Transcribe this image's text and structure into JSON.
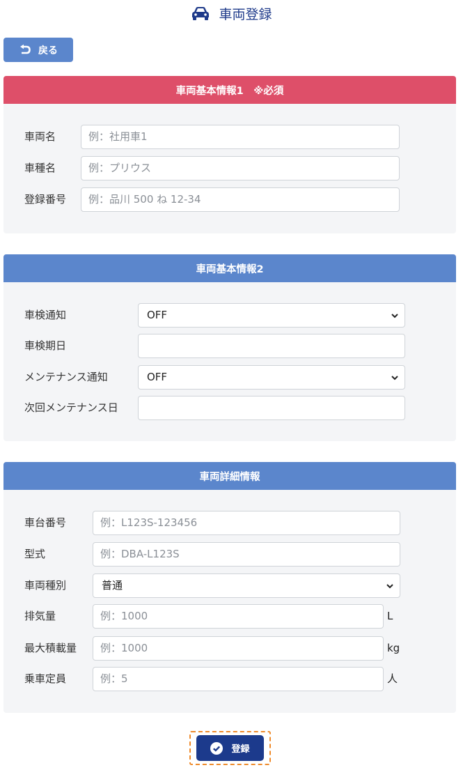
{
  "header": {
    "title": "車両登録",
    "icon": "car-icon"
  },
  "back_button": {
    "label": "戻る",
    "icon": "return-arrow-icon"
  },
  "sections": {
    "basic1": {
      "title": "車両基本情報1　※必須",
      "color": "#de4f69",
      "fields": [
        {
          "label": "車両名",
          "placeholder": "例：社用車1"
        },
        {
          "label": "車種名",
          "placeholder": "例：プリウス"
        },
        {
          "label": "登録番号",
          "placeholder": "例：品川 500 ね 12-34"
        }
      ]
    },
    "basic2": {
      "title": "車両基本情報2",
      "color": "#5b86cc",
      "fields": [
        {
          "label": "車検通知",
          "value": "OFF",
          "type": "select"
        },
        {
          "label": "車検期日",
          "value": "",
          "type": "input"
        },
        {
          "label": "メンテナンス通知",
          "value": "OFF",
          "type": "select"
        },
        {
          "label": "次回メンテナンス日",
          "value": "",
          "type": "input"
        }
      ]
    },
    "detail": {
      "title": "車両詳細情報",
      "color": "#5b86cc",
      "fields": [
        {
          "label": "車台番号",
          "placeholder": "例：L123S-123456"
        },
        {
          "label": "型式",
          "placeholder": "例：DBA-L123S"
        },
        {
          "label": "車両種別",
          "value": "普通",
          "type": "select"
        },
        {
          "label": "排気量",
          "placeholder": "例：1000",
          "unit": "L"
        },
        {
          "label": "最大積載量",
          "placeholder": "例：1000",
          "unit": "kg"
        },
        {
          "label": "乗車定員",
          "placeholder": "例：5",
          "unit": "人"
        }
      ]
    }
  },
  "submit_button": {
    "label": "登録",
    "icon": "check-circle-icon",
    "color": "#1c3a8c"
  }
}
